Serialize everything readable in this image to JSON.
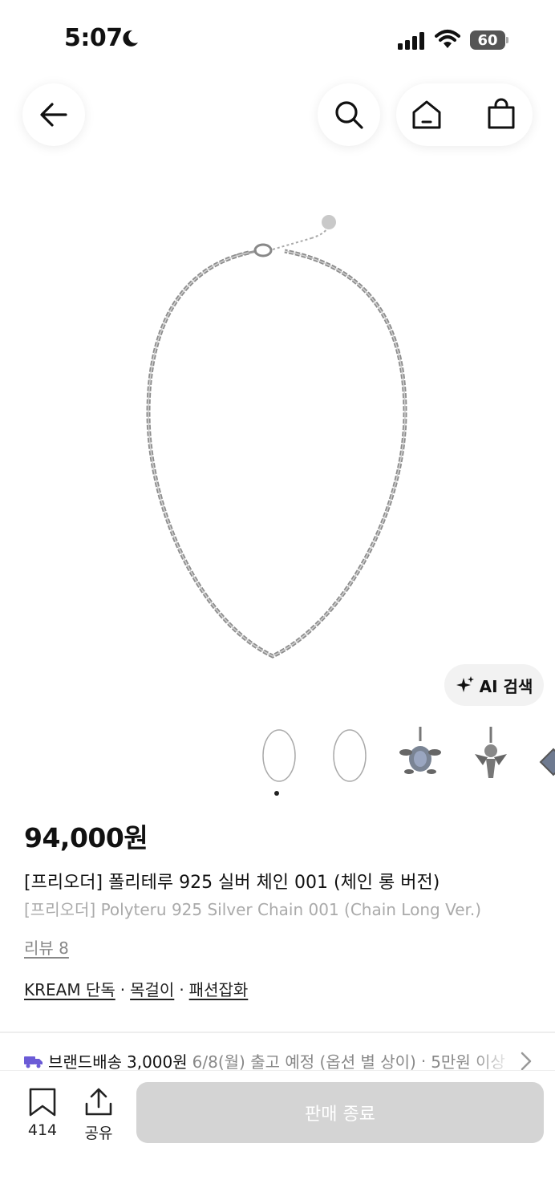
{
  "status_bar": {
    "time": "5:07",
    "battery": "60"
  },
  "ai_search": {
    "label": "AI 검색"
  },
  "product": {
    "price": "94,000원",
    "title_ko": "[프리오더] 폴리테루 925 실버 체인 001 (체인 롱 버전)",
    "title_en": "[프리오더] Polyteru 925 Silver Chain 001 (Chain Long Ver.)",
    "review_label": "리뷰 8",
    "categories": [
      "KREAM 단독",
      "목걸이",
      "패션잡화"
    ],
    "category_separator": "·"
  },
  "thumbnails": [
    "chain-thumb-1",
    "chain-thumb-2",
    "turtle-pendant-thumb",
    "angel-pendant-thumb",
    "partial-pendant-thumb"
  ],
  "shipping": {
    "label": "브랜드배송",
    "fee": "3,000원",
    "date": "6/8(월) 출고 예정 (옵션 별 상이)",
    "separator": "·",
    "extra": "5만원 이상"
  },
  "bottom": {
    "bookmark_count": "414",
    "share_label": "공유",
    "sold_out_label": "판매 종료"
  },
  "colors": {
    "disabled_button": "#d4d4d4",
    "truck": "#6b5bd6"
  }
}
